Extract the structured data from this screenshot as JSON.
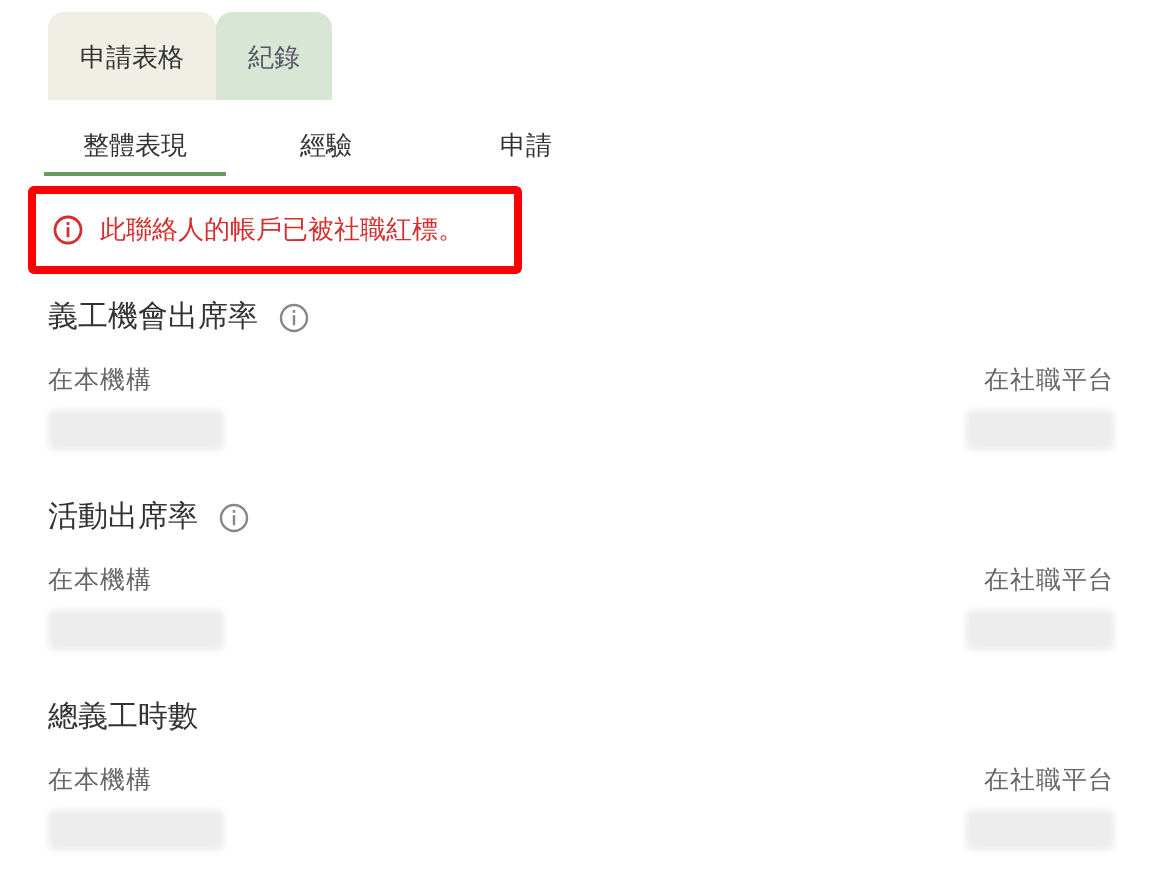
{
  "tabs": [
    {
      "label": "申請表格",
      "selected": false
    },
    {
      "label": "紀錄",
      "selected": true
    }
  ],
  "sub_tabs": [
    {
      "label": "整體表現",
      "selected": true
    },
    {
      "label": "經驗",
      "selected": false
    },
    {
      "label": "申請",
      "selected": false
    }
  ],
  "alert": {
    "text": "此聯絡人的帳戶已被社職紅標。"
  },
  "sections": [
    {
      "title": "義工機會出席率",
      "info": true,
      "left_label": "在本機構",
      "right_label": "在社職平台"
    },
    {
      "title": "活動出席率",
      "info": true,
      "left_label": "在本機構",
      "right_label": "在社職平台"
    },
    {
      "title": "總義工時數",
      "info": false,
      "left_label": "在本機構",
      "right_label": "在社職平台"
    }
  ]
}
